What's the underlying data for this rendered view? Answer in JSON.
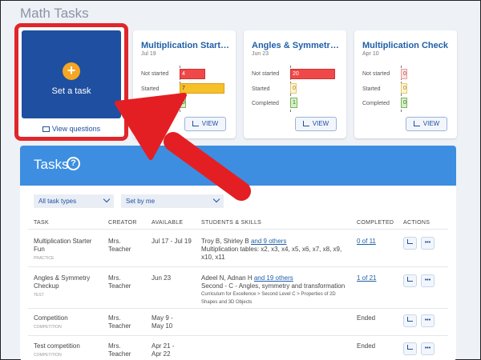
{
  "page_title": "Math Tasks",
  "set_task": {
    "label": "Set a task",
    "plus": "+",
    "view_questions": "View questions"
  },
  "cards": [
    {
      "title": "Multiplication Starter ...",
      "date": "Jul 19",
      "rows": [
        {
          "label": "Not started",
          "value": "4",
          "color": "red",
          "fill": 0.35
        },
        {
          "label": "Started",
          "value": "7",
          "color": "yellow",
          "fill": 0.62
        },
        {
          "label": "Completed",
          "value": "0",
          "color": "green",
          "fill": 0
        }
      ],
      "view_label": "VIEW"
    },
    {
      "title": "Angles & Symmetry C...",
      "date": "Jun 23",
      "rows": [
        {
          "label": "Not started",
          "value": "20",
          "color": "red",
          "fill": 1
        },
        {
          "label": "Started",
          "value": "0",
          "color": "yellow",
          "fill": 0
        },
        {
          "label": "Completed",
          "value": "1",
          "color": "green",
          "fill": 0.05
        }
      ],
      "view_label": "VIEW"
    },
    {
      "title": "Multiplication Check",
      "date": "Apr 10",
      "rows": [
        {
          "label": "Not started",
          "value": "0",
          "color": "red",
          "fill": 0
        },
        {
          "label": "Started",
          "value": "0",
          "color": "yellow",
          "fill": 0
        },
        {
          "label": "Completed",
          "value": "0",
          "color": "green",
          "fill": 0
        }
      ],
      "view_label": "VIEW"
    }
  ],
  "tasks": {
    "title": "Tasks",
    "help": "?",
    "filter_type": "All task types",
    "filter_owner": "Set by me",
    "columns": {
      "task": "TASK",
      "creator": "CREATOR",
      "available": "AVAILABLE",
      "students": "STUDENTS & SKILLS",
      "completed": "COMPLETED",
      "actions": "ACTIONS"
    },
    "rows": [
      {
        "name": "Multiplication Starter Fun",
        "kind": "PRACTICE",
        "creator": "Mrs. Teacher",
        "available": "Jul 17 - Jul 19",
        "students": "Troy B, Shirley B",
        "others": "and 9 others",
        "skills": "Multiplication tables: x2, x3, x4, x5, x6, x7, x8, x9, x10, x11",
        "curriculum": "",
        "completed": "0 of 11"
      },
      {
        "name": "Angles & Symmetry Checkup",
        "kind": "TEST",
        "creator": "Mrs. Teacher",
        "available": "Jun 23",
        "students": "Adeel N, Adnan H",
        "others": "and 19 others",
        "skills": "Second - C - Angles, symmetry and transformation",
        "curriculum": "Curriculum for Excellence > Second Level C > Properties of 2D Shapes and 3D Objects",
        "completed": "1 of 21"
      },
      {
        "name": "Competition",
        "kind": "COMPETITION",
        "creator": "Mrs. Teacher",
        "available": "May 9 - May 10",
        "students": "",
        "others": "",
        "skills": "",
        "curriculum": "",
        "completed": "Ended"
      },
      {
        "name": "Test competition",
        "kind": "COMPETITION",
        "creator": "Mrs. Teacher",
        "available": "Apr 21 - Apr 22",
        "students": "",
        "others": "",
        "skills": "",
        "curriculum": "",
        "completed": "Ended"
      }
    ],
    "chart_icon": "chart-icon",
    "more_label": "•••"
  },
  "colors": {
    "accent_blue": "#3d8ee0",
    "dark_blue": "#1f4fa0",
    "highlight_red": "#e0262a",
    "orange": "#f5a623"
  }
}
